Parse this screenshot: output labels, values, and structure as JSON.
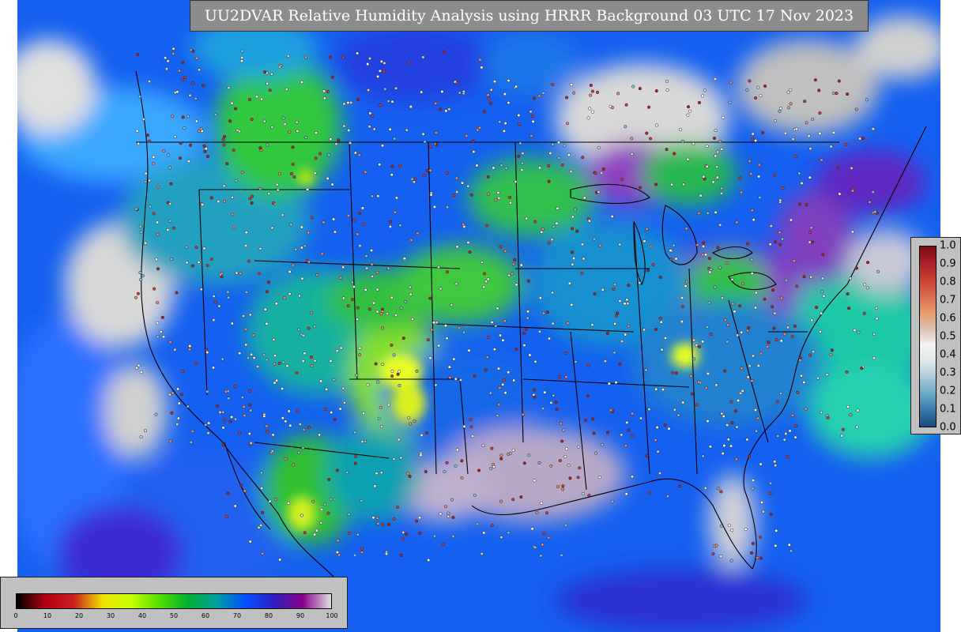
{
  "title": "UU2DVAR Relative Humidity Analysis using HRRR Background 03 UTC 17 Nov 2023",
  "rh_colorbar": {
    "ticks": [
      "0",
      "10",
      "20",
      "30",
      "40",
      "50",
      "60",
      "70",
      "80",
      "90",
      "100"
    ],
    "colors": [
      "#000000",
      "#b00010",
      "#cc2020",
      "#f0e000",
      "#c8ff00",
      "#50e000",
      "#00b030",
      "#00a0a0",
      "#0050ff",
      "#3020c0",
      "#8a008a",
      "#e0e0e0"
    ]
  },
  "increment_colorbar": {
    "ticks": [
      "1.0",
      "0.9",
      "0.8",
      "0.7",
      "0.6",
      "0.5",
      "0.4",
      "0.3",
      "0.2",
      "0.1",
      "0.0"
    ],
    "colors": [
      "#7a0c10",
      "#a82028",
      "#c84030",
      "#d86a50",
      "#e89a6a",
      "#d8c0b0",
      "#f4f0f0",
      "#e0e8ec",
      "#a8c8d8",
      "#6aa8c8",
      "#3a78a8",
      "#1a4a80"
    ]
  }
}
